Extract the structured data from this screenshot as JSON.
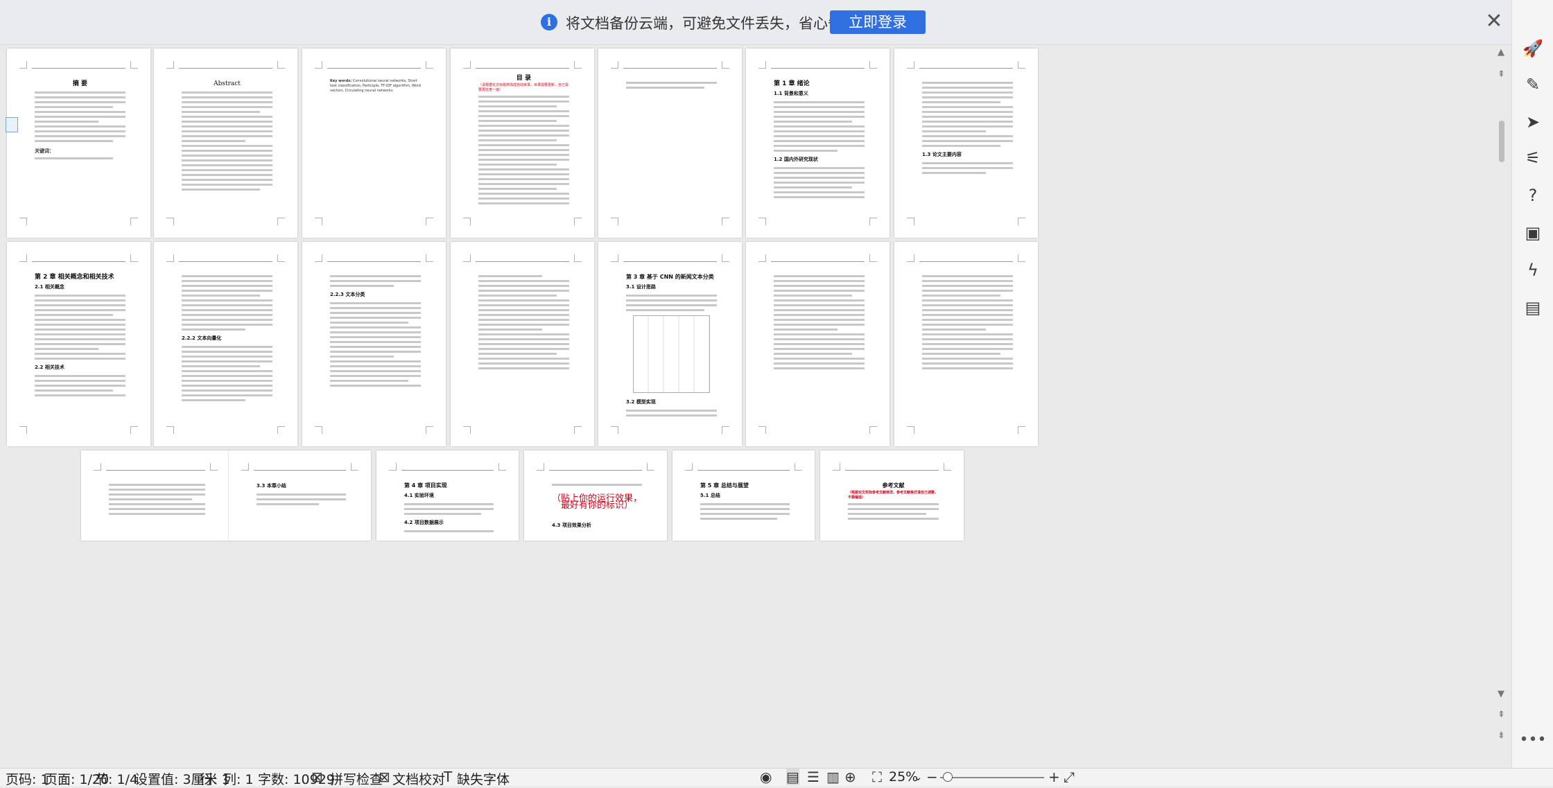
{
  "notification": {
    "message": "将文档备份云端，可避免文件丢失，省心省事",
    "login_label": "立即登录",
    "info_icon": "i",
    "close_icon": "✕"
  },
  "right_toolbar": [
    {
      "name": "rocket-icon",
      "glyph": "🚀"
    },
    {
      "name": "pen-icon",
      "glyph": "✎"
    },
    {
      "name": "cursor-icon",
      "glyph": "➤"
    },
    {
      "name": "sliders-icon",
      "glyph": "⚟"
    },
    {
      "name": "help-icon",
      "glyph": "?"
    },
    {
      "name": "image-edit-icon",
      "glyph": "▣"
    },
    {
      "name": "lightning-icon",
      "glyph": "ϟ"
    },
    {
      "name": "book-icon",
      "glyph": "▤"
    }
  ],
  "more_icon": "•••",
  "pages": {
    "p1_title": "摘  要",
    "p1_keywords": "关键词：",
    "p2_title": "Abstract",
    "p3_keywords": "Key words:",
    "p3_keywords_text": "Convolutional neural networks, Short text classification, Participle, TF-IDF algorithm, Word vectors, Circulating neural networks",
    "p4_title": "目  录",
    "p4_note": "（请根据论文标题修改成自动目录，目录需要更新，自己需要再检查一遍）",
    "p6_heading": "第 1 章  绪论",
    "p6_sub1": "1.1 背景和意义",
    "p6_sub2": "1.2 国内外研究现状",
    "p7_sub": "1.3 论文主要内容",
    "p8_heading": "第 2 章  相关概念和相关技术",
    "p8_sub1": "2.1 相关概念",
    "p8_sub2": "2.2 相关技术",
    "p9_sub": "2.2.2 文本向量化",
    "p10_sub": "2.2.3 文本分类",
    "p12_heading": "第 3 章  基于 CNN 的新闻文本分类",
    "p12_sub1": "3.1 设计思路",
    "p12_sub2": "3.2 模型实现",
    "p15_sub": "3.3 本章小结",
    "p16_heading": "第 4 章  项目实现",
    "p16_sub1": "4.1 实验环境",
    "p16_sub2": "4.2 项目数据展示",
    "p17_red": "（贴上你的运行效果，最好有你的标识）",
    "p17_sub": "4.3 项目效果分析",
    "p18_heading": "第 5 章  总结与展望",
    "p18_sub": "5.1 总结",
    "p19_heading": "参考文献",
    "p19_note": "（根据论文实际参考文献修改，参考文献格式请自己调整，不要编造）"
  },
  "status_bar": {
    "page": "页码: 1",
    "page_of": "页面: 1/20",
    "section": "节: 1/4",
    "setting": "设置值: 3厘米",
    "row": "行: 1",
    "col": "列: 1",
    "word_count": "字数: 10929",
    "spell_check": "拼写检查",
    "doc_proof": "文档校对",
    "missing_font": "缺失字体",
    "zoom": "25%",
    "zoom_level": 0.25
  }
}
